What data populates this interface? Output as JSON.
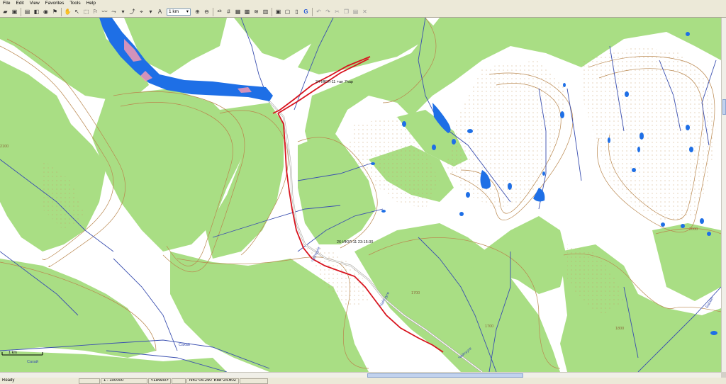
{
  "menu": [
    "File",
    "Edit",
    "View",
    "Favorites",
    "Tools",
    "Help"
  ],
  "toolbar": {
    "scale_value": "1 km",
    "google_icon": "G"
  },
  "map": {
    "labels": {
      "waypoint_top": "24-ИЮЛ-11 +an 7hap",
      "waypoint_mid": "26-ИЮЛ-11 23:15:30",
      "scale_bar": "1 km",
      "river_left": "Сахай",
      "river_bottom": "Сахай",
      "river_right": "Баскит",
      "stream_mid": "Чайтууге",
      "stream_lower": "Чайтууге",
      "stream_bottom": "Чайтууге"
    },
    "elevations": [
      "2100",
      "1700",
      "1700",
      "1800",
      "2000"
    ],
    "colors": {
      "forest": "#a9de84",
      "open": "#ffffff",
      "water": "#1e6fe6",
      "track": "#d8141e",
      "contour": "#b9874e",
      "stream": "#3a4fb0"
    }
  },
  "status": {
    "ready": "Ready",
    "scale": "1 : 100000",
    "level": "<Level0>",
    "coordinates": "N51°04.290' E88°24.602'"
  }
}
